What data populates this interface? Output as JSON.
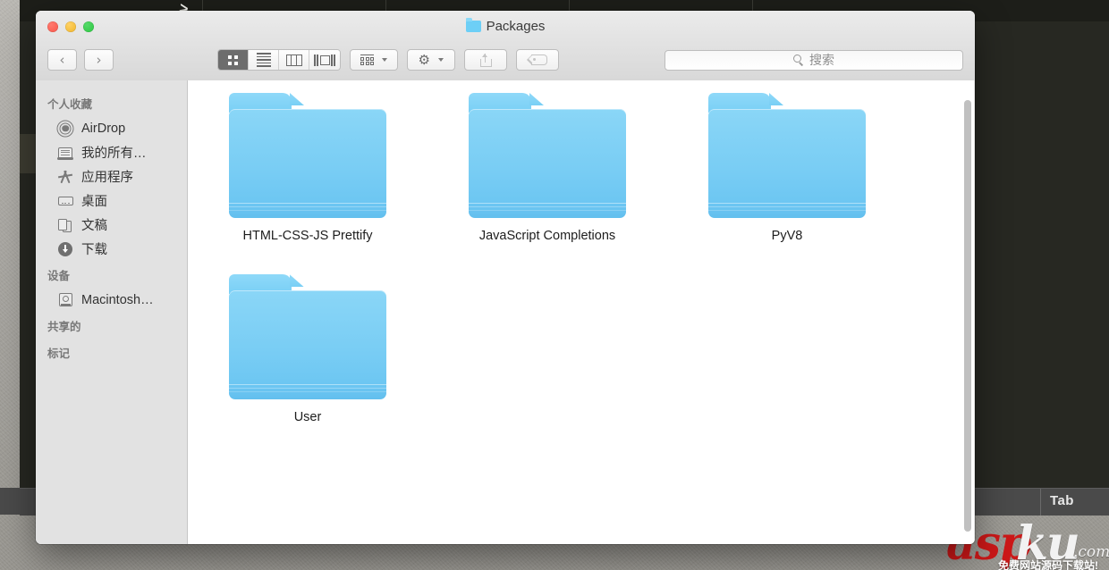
{
  "window": {
    "title": "Packages",
    "title_icon": "folder-icon"
  },
  "traffic_lights": {
    "close": "close-button",
    "minimize": "minimize-button",
    "zoom": "zoom-button"
  },
  "toolbar": {
    "back_label": "‹",
    "forward_label": "›",
    "view_modes": [
      {
        "name": "icon-view",
        "icon": "grid-view-icon",
        "active": true
      },
      {
        "name": "list-view",
        "icon": "list-view-icon",
        "active": false
      },
      {
        "name": "column-view",
        "icon": "column-view-icon",
        "active": false
      },
      {
        "name": "gallery-view",
        "icon": "coverflow-view-icon",
        "active": false
      }
    ],
    "arrange_icon": "arrange-by-icon",
    "action_icon": "gear-icon",
    "share_icon": "share-icon",
    "tag_icon": "tag-icon"
  },
  "search": {
    "placeholder": "搜索",
    "value": "",
    "icon": "search-icon"
  },
  "sidebar": {
    "sections": [
      {
        "header": "个人收藏",
        "items": [
          {
            "label": "AirDrop",
            "icon": "airdrop-icon"
          },
          {
            "label": "我的所有…",
            "icon": "all-my-files-icon"
          },
          {
            "label": "应用程序",
            "icon": "applications-icon"
          },
          {
            "label": "桌面",
            "icon": "desktop-icon"
          },
          {
            "label": "文稿",
            "icon": "documents-icon"
          },
          {
            "label": "下载",
            "icon": "downloads-icon"
          }
        ]
      },
      {
        "header": "设备",
        "items": [
          {
            "label": "Macintosh…",
            "icon": "hard-drive-icon"
          }
        ]
      },
      {
        "header": "共享的",
        "items": []
      },
      {
        "header": "标记",
        "items": []
      }
    ]
  },
  "files": [
    {
      "name": "HTML-CSS-JS Prettify",
      "type": "folder"
    },
    {
      "name": "JavaScript Completions",
      "type": "folder"
    },
    {
      "name": "PyV8",
      "type": "folder"
    },
    {
      "name": "User",
      "type": "folder"
    }
  ],
  "background": {
    "status_bar_text": "Tab",
    "watermark": {
      "brand_red": "asp",
      "brand_white": "ku",
      "tld": ".com",
      "tagline": "免费网站源码下载站!"
    }
  },
  "colors": {
    "folder_blue": "#79cdf4",
    "titlebar": "#e2e2e2",
    "sidebar": "#e2e2e2",
    "accent_red": "#cc1818"
  }
}
